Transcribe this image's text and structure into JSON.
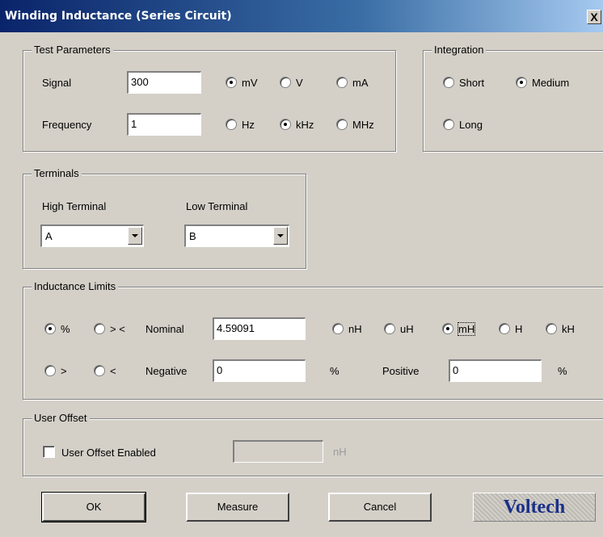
{
  "window": {
    "title": "Winding Inductance (Series Circuit)",
    "close": "X"
  },
  "test_params": {
    "legend": "Test Parameters",
    "signal_label": "Signal",
    "signal_value": "300",
    "signal_units": [
      "mV",
      "V",
      "mA"
    ],
    "signal_selected": 0,
    "frequency_label": "Frequency",
    "frequency_value": "1",
    "freq_units": [
      "Hz",
      "kHz",
      "MHz"
    ],
    "freq_selected": 1
  },
  "integration": {
    "legend": "Integration",
    "options": [
      "Short",
      "Medium",
      "Long"
    ],
    "selected": 1
  },
  "terminals": {
    "legend": "Terminals",
    "high_label": "High Terminal",
    "high_value": "A",
    "low_label": "Low Terminal",
    "low_value": "B"
  },
  "limits": {
    "legend": "Inductance Limits",
    "mode_options": [
      "%",
      "> <",
      ">",
      "<"
    ],
    "mode_selected": 0,
    "nominal_label": "Nominal",
    "nominal_value": "4.59091",
    "units": [
      "nH",
      "uH",
      "mH",
      "H",
      "kH"
    ],
    "unit_selected": 2,
    "negative_label": "Negative",
    "negative_value": "0",
    "negative_unit": "%",
    "positive_label": "Positive",
    "positive_value": "0",
    "positive_unit": "%"
  },
  "offset": {
    "legend": "User Offset",
    "enabled_label": "User Offset Enabled",
    "value": "",
    "unit": "nH"
  },
  "buttons": {
    "ok": "OK",
    "measure": "Measure",
    "cancel": "Cancel"
  },
  "logo": "Voltech"
}
